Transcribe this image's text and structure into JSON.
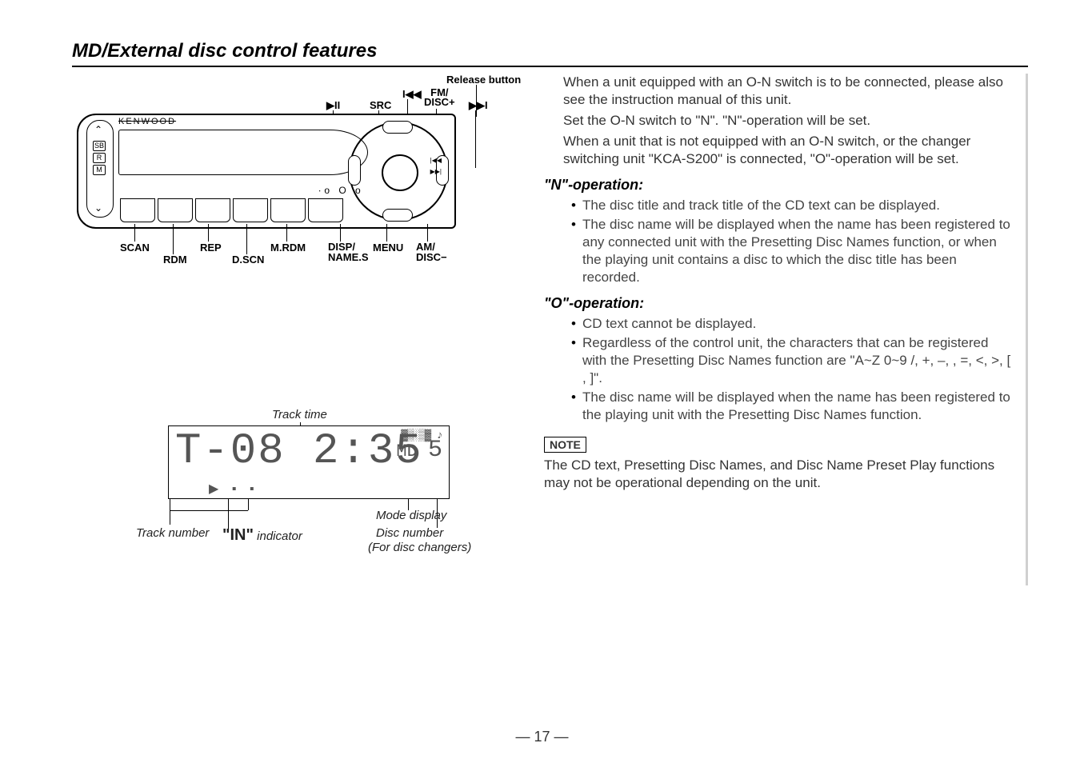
{
  "title": "MD/External disc control features",
  "faceplate": {
    "brand": "KENWOOD",
    "labels": {
      "release": "Release button",
      "play_pause": "▶II",
      "src": "SRC",
      "prev": "I◀◀",
      "fwd": "▶▶I",
      "fm_disc_plus": "FM/\nDISC+",
      "am_disc_minus": "AM/\nDISC−",
      "scan": "SCAN",
      "rdm": "RDM",
      "rep": "REP",
      "dscn": "D.SCN",
      "mrdm": "M.RDM",
      "disp_names": "DISP/\nNAME.S",
      "menu": "MENU"
    }
  },
  "lcd": {
    "track_time_label": "Track time",
    "mode_display_label": "Mode display",
    "track_number_label": "Track number",
    "disc_number_label": "Disc number",
    "disc_number_sub": "(For disc changers)",
    "in_indicator_label": "indicator",
    "in_indicator_bold": "\"IN\"",
    "main_text": "T-08  2:35",
    "mode": "MD",
    "disc": "5"
  },
  "right": {
    "p1": "When a unit equipped with an O-N switch is to be connected, please also see the instruction manual of this unit.",
    "p2": "Set the O-N switch to \"N\". \"N\"-operation will be set.",
    "p3": "When a unit that is not equipped with an O-N switch, or the changer switching unit \"KCA-S200\" is connected, \"O\"-operation will be set.",
    "n_head": "\"N\"-operation:",
    "n_items": [
      "The disc title and track title of the CD text can be displayed.",
      "The disc name will be displayed when the name has been registered to any connected unit with the Presetting Disc Names function, or when the playing unit contains a disc to which the disc title has been recorded."
    ],
    "o_head": "\"O\"-operation:",
    "o_items": [
      "CD text cannot be displayed.",
      "Regardless of the control unit, the characters that can be registered with the Presetting Disc Names function are \"A~Z  0~9  /, +, –,   , =, <, >, [ , ]\".",
      "The disc name will be displayed when the name has been registered to the playing unit with the Presetting Disc Names function."
    ],
    "note_label": "NOTE",
    "note_text": "The CD text, Presetting Disc Names, and Disc Name Preset Play functions may not be operational depending on the unit."
  },
  "page_number": "— 17 —"
}
